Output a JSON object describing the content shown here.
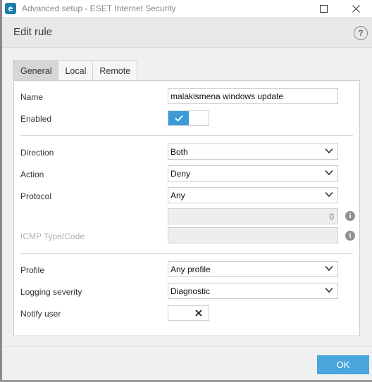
{
  "window": {
    "app_icon_letter": "e",
    "title": "Advanced setup - ESET Internet Security",
    "controls": {
      "minimize": "—",
      "maximize": "☐",
      "close": "✕"
    }
  },
  "dialog": {
    "title": "Edit rule",
    "help_label": "?"
  },
  "tabs": [
    {
      "label": "General",
      "active": true
    },
    {
      "label": "Local",
      "active": false
    },
    {
      "label": "Remote",
      "active": false
    }
  ],
  "form": {
    "name": {
      "label": "Name",
      "value": "malakismena windows update"
    },
    "enabled": {
      "label": "Enabled",
      "state": true
    },
    "direction": {
      "label": "Direction",
      "value": "Both"
    },
    "action": {
      "label": "Action",
      "value": "Deny"
    },
    "protocol": {
      "label": "Protocol",
      "value": "Any"
    },
    "protocol_number": {
      "value": "0"
    },
    "icmp": {
      "label": "ICMP Type/Code",
      "value": ""
    },
    "profile": {
      "label": "Profile",
      "value": "Any profile"
    },
    "logging": {
      "label": "Logging severity",
      "value": "Diagnostic"
    },
    "notify": {
      "label": "Notify user",
      "state": false
    }
  },
  "info_icon_glyph": "i",
  "ok_label": "OK",
  "colors": {
    "accent": "#3a9bd8",
    "ok_button": "#4aa5dc"
  }
}
